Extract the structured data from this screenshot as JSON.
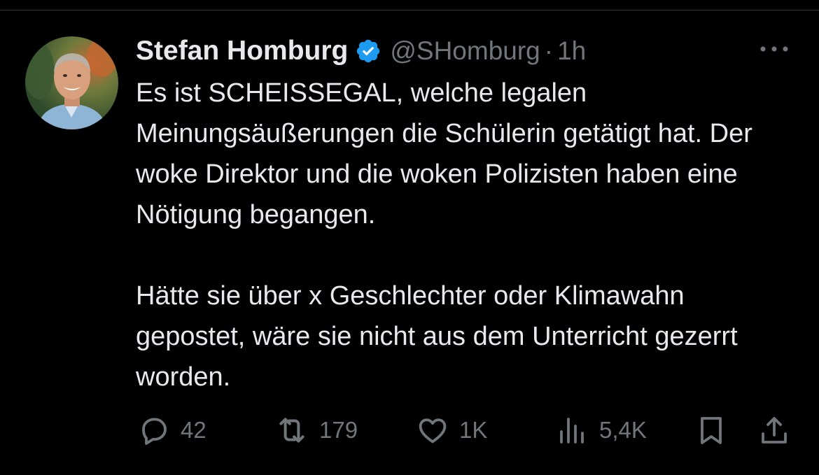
{
  "tweet": {
    "author_name": "Stefan Homburg",
    "handle": "@SHomburg",
    "separator": "·",
    "time": "1h",
    "paragraphs": [
      "Es ist SCHEISSEGAL, welche legalen Meinungsäußerungen die Schülerin getätigt hat. Der woke Direktor und die woken Polizisten haben eine Nötigung begangen.",
      "Hätte sie über x Geschlechter oder Klimawahn gepostet, wäre sie nicht aus dem Unterricht gezerrt worden."
    ],
    "replies": "42",
    "retweets": "179",
    "likes": "1K",
    "views": "5,4K"
  },
  "icons": {
    "verified": "verified-badge-icon",
    "more": "more-dots-icon",
    "reply": "reply-bubble-icon",
    "retweet": "retweet-icon",
    "like": "heart-icon",
    "views": "views-bar-chart-icon",
    "bookmark": "bookmark-icon",
    "share": "share-upload-icon"
  },
  "colors": {
    "background": "#000000",
    "text": "#e7e9ea",
    "muted": "#71767b",
    "verified": "#1d9bf0",
    "divider": "#2f3336"
  }
}
